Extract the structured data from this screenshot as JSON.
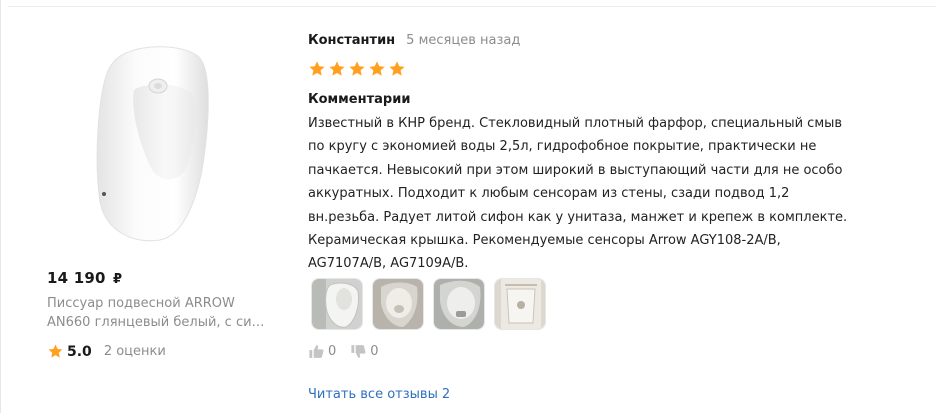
{
  "product": {
    "image_icon": "urinal-product-photo",
    "price": "14 190",
    "currency": "₽",
    "title_line1": "Писсуар подвесной ARROW",
    "title_line2": "AN660 глянцевый белый, с си…",
    "rating_score": "5.0",
    "rating_count": "2 оценки"
  },
  "review": {
    "author": "Константин",
    "date": "5 месяцев назад",
    "stars": 5,
    "comment_label": "Комментарии",
    "comment_lines": [
      "Известный в КНР бренд. Стекловидный плотный фарфор, специальный смыв",
      "по кругу с экономией воды 2,5л, гидрофобное покрытие, практически не",
      "пачкается. Невысокий при этом широкий в выступающий части для не особо",
      "аккуратных. Подходит к любым сенсорам из стены, сзади подвод 1,2",
      "вн.резьба. Радует литой сифон как у унитаза, манжет и крепеж в комплекте.",
      "Керамическая крышка. Рекомендуемые сенсоры Arrow AGY108-2A/B,",
      "AG7107A/B, AG7109A/B."
    ],
    "photos": [
      "photo-1",
      "photo-2",
      "photo-3",
      "photo-4"
    ],
    "likes": "0",
    "dislikes": "0",
    "read_all_label": "Читать все отзывы",
    "read_all_count": "2"
  },
  "colors": {
    "star": "#ffa01e",
    "link": "#2f6fbd",
    "muted": "#8c8c8c"
  }
}
